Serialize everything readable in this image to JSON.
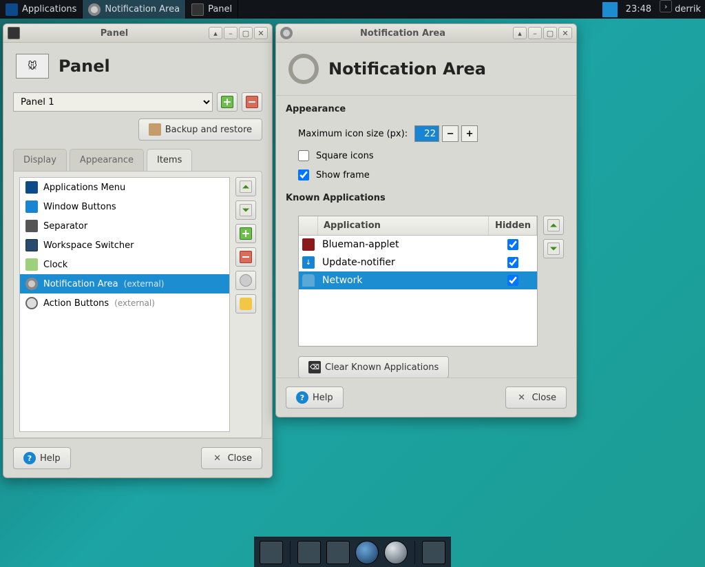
{
  "taskbar": {
    "apps_label": "Applications",
    "active_task": "Notification Area",
    "other_task": "Panel",
    "clock": "23:48",
    "user": "derrik"
  },
  "panel_window": {
    "title": "Panel",
    "header": "Panel",
    "selector": "Panel 1",
    "backup_label": "Backup and restore",
    "tabs": {
      "display": "Display",
      "appearance": "Appearance",
      "items": "Items"
    },
    "items": [
      {
        "name": "Applications Menu",
        "ext": ""
      },
      {
        "name": "Window Buttons",
        "ext": ""
      },
      {
        "name": "Separator",
        "ext": ""
      },
      {
        "name": "Workspace Switcher",
        "ext": ""
      },
      {
        "name": "Clock",
        "ext": ""
      },
      {
        "name": "Notification Area",
        "ext": "(external)",
        "selected": true
      },
      {
        "name": "Action Buttons",
        "ext": "(external)"
      }
    ],
    "help": "Help",
    "close": "Close"
  },
  "notif_window": {
    "title": "Notification Area",
    "header": "Notification Area",
    "section_appearance": "Appearance",
    "max_icon_label": "Maximum icon size (px):",
    "max_icon_value": "22",
    "square_icons": "Square icons",
    "square_icons_checked": false,
    "show_frame": "Show frame",
    "show_frame_checked": true,
    "section_known": "Known Applications",
    "col_app": "Application",
    "col_hidden": "Hidden",
    "rows": [
      {
        "name": "Blueman-applet",
        "hidden": true
      },
      {
        "name": "Update-notifier",
        "hidden": true
      },
      {
        "name": "Network",
        "hidden": true,
        "selected": true
      }
    ],
    "clear_known": "Clear Known Applications",
    "help": "Help",
    "close": "Close"
  }
}
